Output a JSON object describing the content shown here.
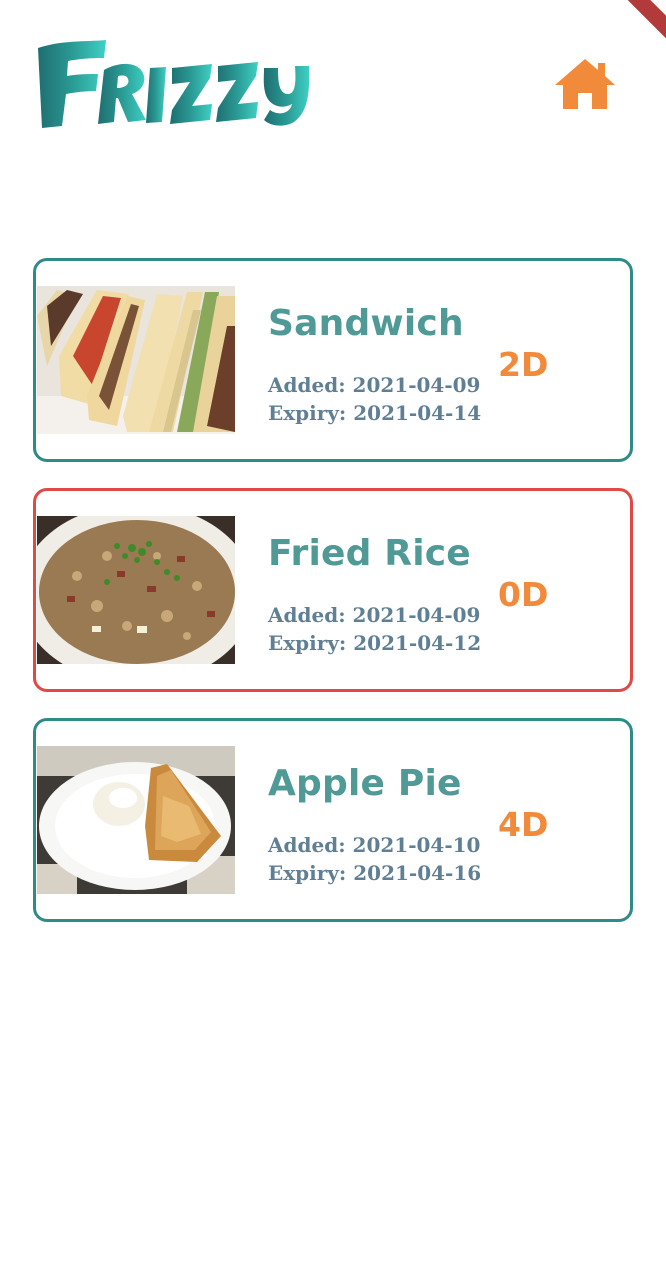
{
  "app": {
    "logo_text": "Frizzy"
  },
  "header": {
    "home_icon": "home-icon"
  },
  "colors": {
    "card_border_ok": "#2f8b86",
    "card_border_expired": "#e04a45",
    "title": "#4f9a96",
    "dates": "#5f7f95",
    "days_badge": "#f28a3c",
    "home_icon": "#f28a3c"
  },
  "items": [
    {
      "name": "Sandwich",
      "added": "Added: 2021-04-09",
      "expiry": "Expiry: 2021-04-14",
      "days_left": "2D",
      "status": "ok",
      "image": "sandwich-photo"
    },
    {
      "name": "Fried Rice",
      "added": "Added: 2021-04-09",
      "expiry": "Expiry: 2021-04-12",
      "days_left": "0D",
      "status": "expired",
      "image": "fried-rice-photo"
    },
    {
      "name": "Apple Pie",
      "added": "Added: 2021-04-10",
      "expiry": "Expiry: 2021-04-16",
      "days_left": "4D",
      "status": "ok",
      "image": "apple-pie-photo"
    }
  ]
}
